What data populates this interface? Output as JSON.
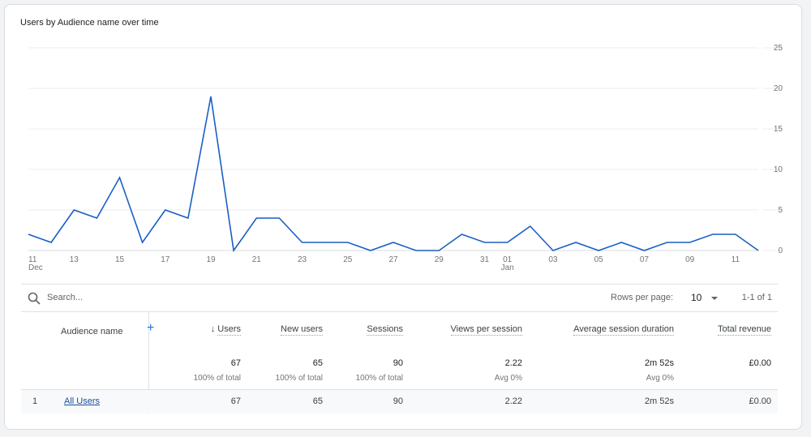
{
  "card": {
    "title": "Users by Audience name over time"
  },
  "chart_data": {
    "type": "line",
    "title": "Users by Audience name over time",
    "xlabel": "",
    "ylabel": "",
    "ylim": [
      0,
      25
    ],
    "yticks": [
      "0",
      "5",
      "10",
      "15",
      "20",
      "25"
    ],
    "ytick_values": [
      0,
      5,
      10,
      15,
      20,
      25
    ],
    "grid": true,
    "y_axis_side": "right",
    "x": [
      "Dec 11",
      "Dec 12",
      "Dec 13",
      "Dec 14",
      "Dec 15",
      "Dec 16",
      "Dec 17",
      "Dec 18",
      "Dec 19",
      "Dec 20",
      "Dec 21",
      "Dec 22",
      "Dec 23",
      "Dec 24",
      "Dec 25",
      "Dec 26",
      "Dec 27",
      "Dec 28",
      "Dec 29",
      "Dec 30",
      "Dec 31",
      "Jan 01",
      "Jan 02",
      "Jan 03",
      "Jan 04",
      "Jan 05",
      "Jan 06",
      "Jan 07",
      "Jan 08",
      "Jan 09",
      "Jan 10",
      "Jan 11",
      "Jan 12"
    ],
    "xticks": [
      {
        "index": 0,
        "label": "11",
        "sub": "Dec"
      },
      {
        "index": 2,
        "label": "13",
        "sub": ""
      },
      {
        "index": 4,
        "label": "15",
        "sub": ""
      },
      {
        "index": 6,
        "label": "17",
        "sub": ""
      },
      {
        "index": 8,
        "label": "19",
        "sub": ""
      },
      {
        "index": 10,
        "label": "21",
        "sub": ""
      },
      {
        "index": 12,
        "label": "23",
        "sub": ""
      },
      {
        "index": 14,
        "label": "25",
        "sub": ""
      },
      {
        "index": 16,
        "label": "27",
        "sub": ""
      },
      {
        "index": 18,
        "label": "29",
        "sub": ""
      },
      {
        "index": 20,
        "label": "31",
        "sub": ""
      },
      {
        "index": 21,
        "label": "01",
        "sub": "Jan"
      },
      {
        "index": 23,
        "label": "03",
        "sub": ""
      },
      {
        "index": 25,
        "label": "05",
        "sub": ""
      },
      {
        "index": 27,
        "label": "07",
        "sub": ""
      },
      {
        "index": 29,
        "label": "09",
        "sub": ""
      },
      {
        "index": 31,
        "label": "11",
        "sub": ""
      }
    ],
    "series": [
      {
        "name": "All Users",
        "color": "#1a5fc4",
        "values": [
          2,
          1,
          5,
          4,
          9,
          1,
          5,
          4,
          19,
          0,
          4,
          4,
          1,
          1,
          1,
          0,
          1,
          0,
          0,
          2,
          1,
          1,
          3,
          0,
          1,
          0,
          1,
          0,
          1,
          1,
          2,
          2,
          0
        ]
      }
    ]
  },
  "toolbar": {
    "search_placeholder": "Search...",
    "rows_per_page_label": "Rows per page:",
    "rows_per_page_value": "10",
    "page_range": "1-1 of 1"
  },
  "table": {
    "dimension_header": "Audience name",
    "add_dimension": "+",
    "sort_indicator": "↓",
    "columns": [
      {
        "label": "Users",
        "total": "67",
        "total_sub": "100% of total"
      },
      {
        "label": "New users",
        "total": "65",
        "total_sub": "100% of total"
      },
      {
        "label": "Sessions",
        "total": "90",
        "total_sub": "100% of total"
      },
      {
        "label": "Views per session",
        "total": "2.22",
        "total_sub": "Avg 0%"
      },
      {
        "label": "Average session duration",
        "total": "2m 52s",
        "total_sub": "Avg 0%"
      },
      {
        "label": "Total revenue",
        "total": "£0.00",
        "total_sub": ""
      }
    ],
    "rows": [
      {
        "index": "1",
        "name": "All Users",
        "values": [
          "67",
          "65",
          "90",
          "2.22",
          "2m 52s",
          "£0.00"
        ]
      }
    ]
  }
}
